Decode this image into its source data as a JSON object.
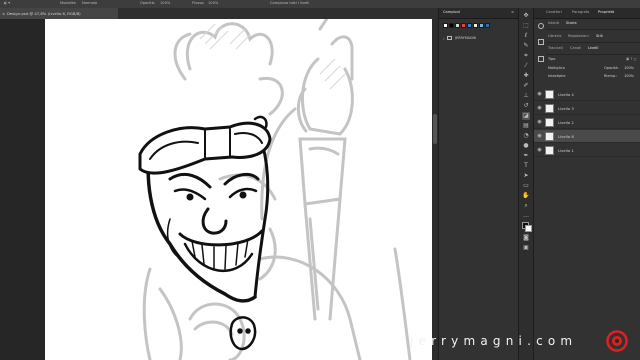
{
  "options_bar": {
    "mode_label": "Modalità:",
    "mode_value": "Normale",
    "opacity_label": "Opacità:",
    "opacity_value": "100%",
    "flow_label": "Flusso:",
    "flow_value": "100%",
    "sample_label": "Campiona tutti i livelli"
  },
  "document_tab": {
    "close": "×",
    "title": "Design.psd @ 47,8% (Livello 6, RGB/8)"
  },
  "swatches_panel": {
    "tab": "Campioni",
    "folder_label": "JERRYMAGNI",
    "colors": [
      "#ffffff",
      "#000000",
      "#d9d9d9",
      "#e8403a",
      "#3b82c4",
      "#f0f0f0",
      "#7fb0d8",
      "#2f6fb0"
    ]
  },
  "properties_tabs": [
    "Caratteri",
    "Paragrafo",
    "Proprietà"
  ],
  "adjust_tabs": [
    "Istanti",
    "Storia"
  ],
  "library_tabs": [
    "Librerie",
    "Regolazioni",
    "Stili"
  ],
  "layers_tabs": [
    "Tracciati",
    "Canali",
    "Livelli"
  ],
  "layers_controls": {
    "kind_label": "Tipo",
    "blend_value": "Moltiplica",
    "opacity_label": "Opacità:",
    "opacity_value": "100%",
    "lock_label": "Blocca:",
    "fill_label": "Riemp.:",
    "fill_value": "100%",
    "search_value": "Intestiphe"
  },
  "layers": [
    {
      "name": "Livello 4",
      "visible": true,
      "selected": false
    },
    {
      "name": "Livello 3",
      "visible": true,
      "selected": false
    },
    {
      "name": "Livello 2",
      "visible": true,
      "selected": false
    },
    {
      "name": "Livello 6",
      "visible": true,
      "selected": true
    },
    {
      "name": "Livello 1",
      "visible": true,
      "selected": false
    }
  ],
  "watermark": {
    "text": "jerrymagni.com"
  }
}
